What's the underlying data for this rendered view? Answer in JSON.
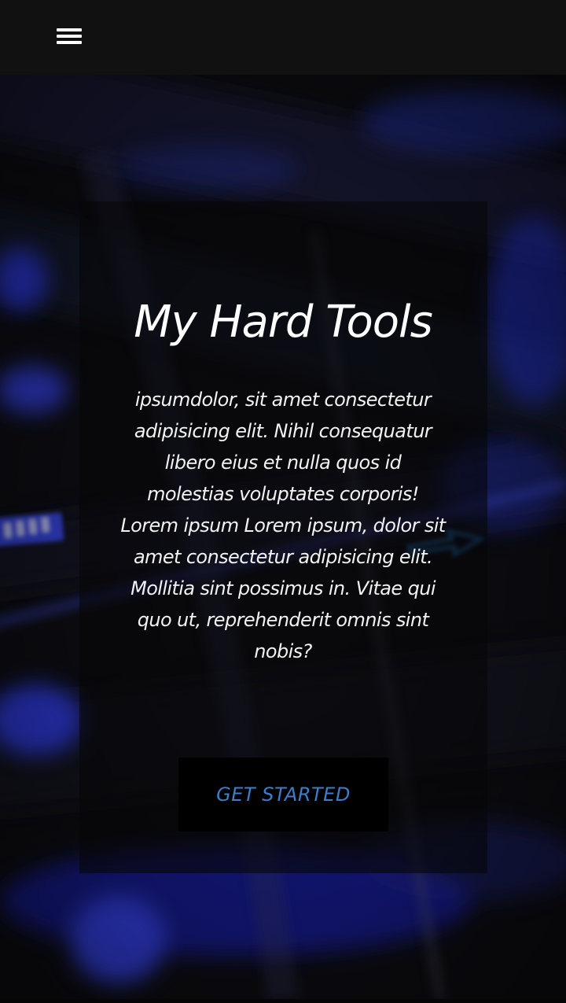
{
  "header": {
    "menu_icon": "hamburger-menu-icon"
  },
  "hero": {
    "background": "blurred-illuminated-keyboard-photo",
    "title": "My Hard Tools",
    "body_lines": [
      "ipsumdolor, sit amet consectetur",
      "adipisicing elit. Nihil consequatur",
      "libero eius et nulla quos id",
      "molestias voluptates corporis!",
      "Lorem ipsum Lorem ipsum, dolor sit",
      "amet consectetur adipisicing elit.",
      "Mollitia sint possimus in. Vitae qui",
      "quo ut, reprehenderit omnis sint",
      "nobis?"
    ],
    "cta_label": "GET STARTED"
  },
  "colors": {
    "topbar_bg": "#111111",
    "accent_blue": "#3f7cc9",
    "keyboard_glow": "#2a38ff"
  }
}
